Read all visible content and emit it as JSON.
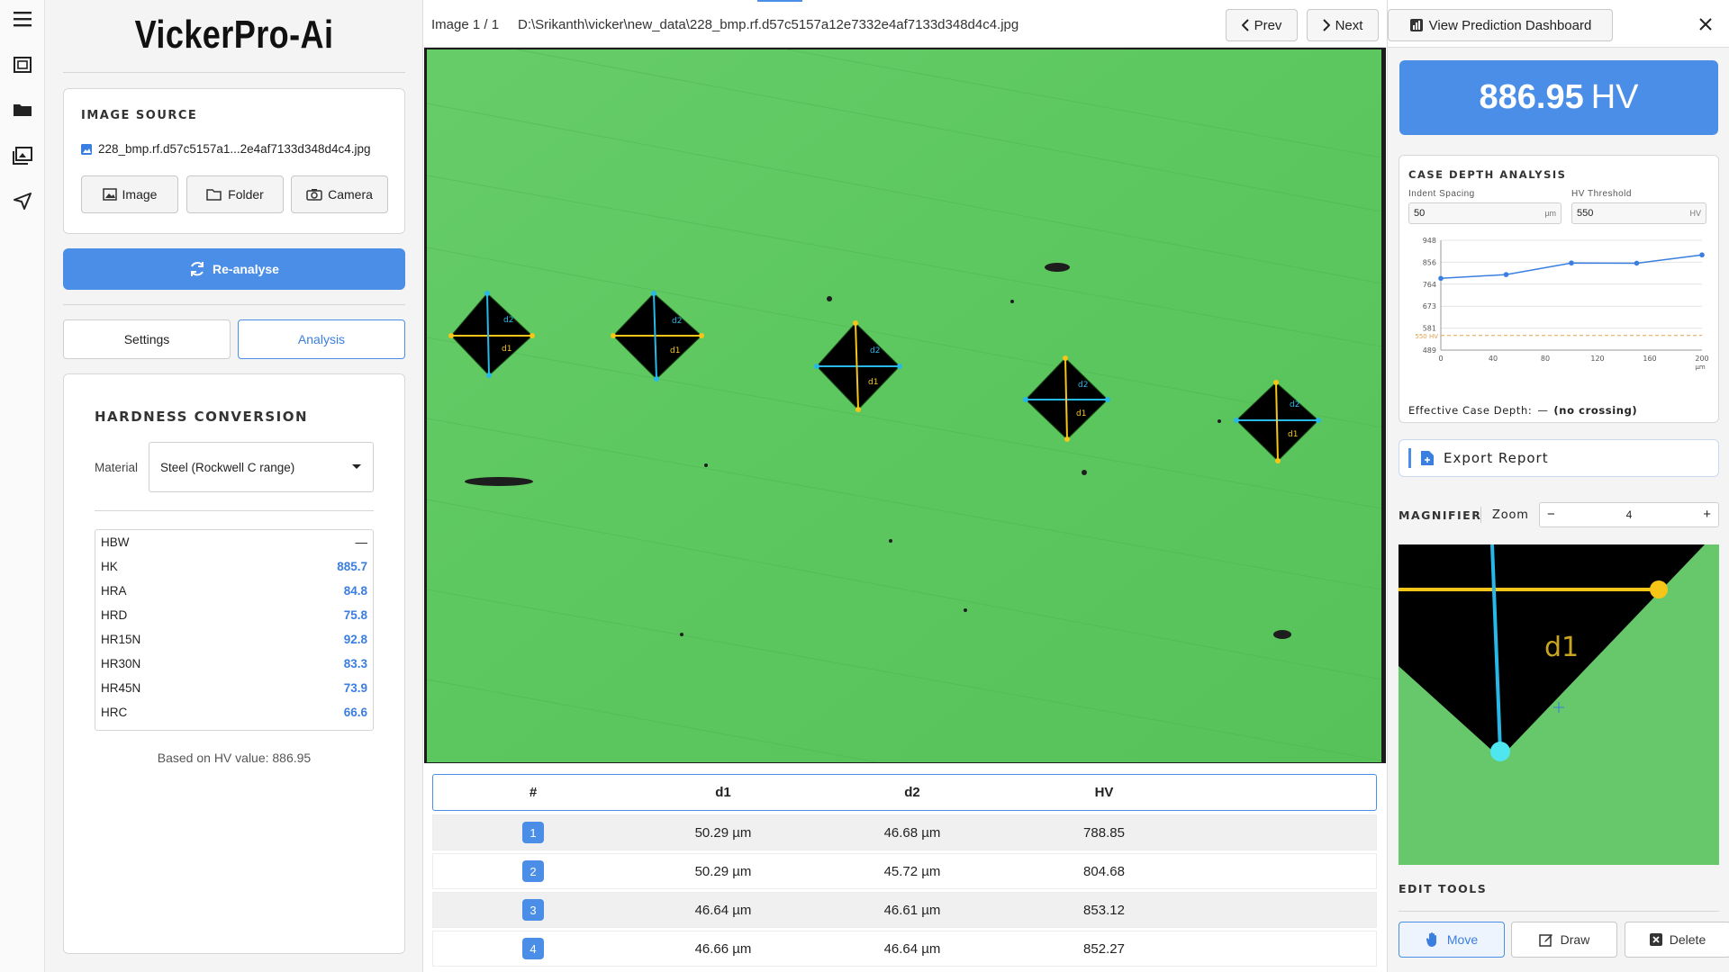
{
  "app": {
    "title": "VickerPro-Ai"
  },
  "rail": {
    "icons": [
      "menu-icon",
      "image-frame-icon",
      "folder-icon",
      "gallery-icon",
      "send-icon"
    ]
  },
  "source": {
    "heading": "IMAGE SOURCE",
    "file": "228_bmp.rf.d57c5157a1...2e4af7133d348d4c4.jpg",
    "buttons": {
      "image": "Image",
      "folder": "Folder",
      "camera": "Camera"
    }
  },
  "actions": {
    "reanalyse": "Re-analyse"
  },
  "tabs": {
    "settings": "Settings",
    "analysis": "Analysis",
    "active": "analysis"
  },
  "conversion": {
    "heading": "HARDNESS CONVERSION",
    "material_label": "Material",
    "material_value": "Steel (Rockwell C range)",
    "rows": [
      {
        "name": "HBW",
        "value": "—"
      },
      {
        "name": "HK",
        "value": "885.7"
      },
      {
        "name": "HRA",
        "value": "84.8"
      },
      {
        "name": "HRD",
        "value": "75.8"
      },
      {
        "name": "HR15N",
        "value": "92.8"
      },
      {
        "name": "HR30N",
        "value": "83.3"
      },
      {
        "name": "HR45N",
        "value": "73.9"
      },
      {
        "name": "HRC",
        "value": "66.6"
      }
    ],
    "based_on": "Based on HV value: 886.95"
  },
  "viewer": {
    "counter": "Image 1 / 1",
    "path": "D:\\Srikanth\\vicker\\new_data\\228_bmp.rf.d57c5157a12e7332e4af7133d348d4c4.jpg",
    "prev": "Prev",
    "next": "Next",
    "dashboard": "View Prediction Dashboard",
    "label_d1": "d1",
    "label_d2": "d2"
  },
  "table": {
    "headers": [
      "#",
      "d1",
      "d2",
      "HV"
    ],
    "rows": [
      {
        "n": "1",
        "d1": "50.29 µm",
        "d2": "46.68 µm",
        "hv": "788.85"
      },
      {
        "n": "2",
        "d1": "50.29 µm",
        "d2": "45.72 µm",
        "hv": "804.68"
      },
      {
        "n": "3",
        "d1": "46.64 µm",
        "d2": "46.61 µm",
        "hv": "853.12"
      },
      {
        "n": "4",
        "d1": "46.66 µm",
        "d2": "46.64 µm",
        "hv": "852.27"
      }
    ]
  },
  "result": {
    "value": "886.95",
    "unit": "HV"
  },
  "case_depth": {
    "heading": "CASE DEPTH ANALYSIS",
    "spacing_label": "Indent Spacing",
    "spacing_value": "50",
    "spacing_unit": "µm",
    "threshold_label": "HV Threshold",
    "threshold_value": "550",
    "threshold_unit": "HV",
    "effective_label": "Effective Case Depth:",
    "effective_dash": "—",
    "effective_value": "(no crossing)"
  },
  "chart_data": {
    "type": "line",
    "x": [
      0,
      40,
      80,
      120,
      160,
      200
    ],
    "values": [
      788.85,
      804.68,
      853.12,
      852.27,
      886.95
    ],
    "x_points": [
      0,
      50,
      100,
      150,
      200
    ],
    "xticks": [
      "0",
      "40",
      "80",
      "120",
      "160",
      "200"
    ],
    "yticks": [
      "948",
      "856",
      "764",
      "673",
      "581",
      "489"
    ],
    "xunit": "µm",
    "ylim": [
      489,
      948
    ],
    "xlim": [
      0,
      200
    ],
    "threshold": 550,
    "threshold_label": "550 HV",
    "grid": true,
    "line_color": "#3a7ee0",
    "threshold_color": "#e0a050"
  },
  "export": {
    "label": "Export Report"
  },
  "magnifier": {
    "heading": "MAGNIFIER",
    "zoom_label": "Zoom",
    "zoom_value": "4",
    "minus": "−",
    "plus": "+",
    "label": "d1"
  },
  "edit_tools": {
    "heading": "EDIT TOOLS",
    "move": "Move",
    "draw": "Draw",
    "delete": "Delete"
  },
  "colors": {
    "accent": "#4a8ee8",
    "image_bg": "#5cc85f",
    "d1_line": "#f5c518",
    "d2_line": "#28b8e8"
  }
}
